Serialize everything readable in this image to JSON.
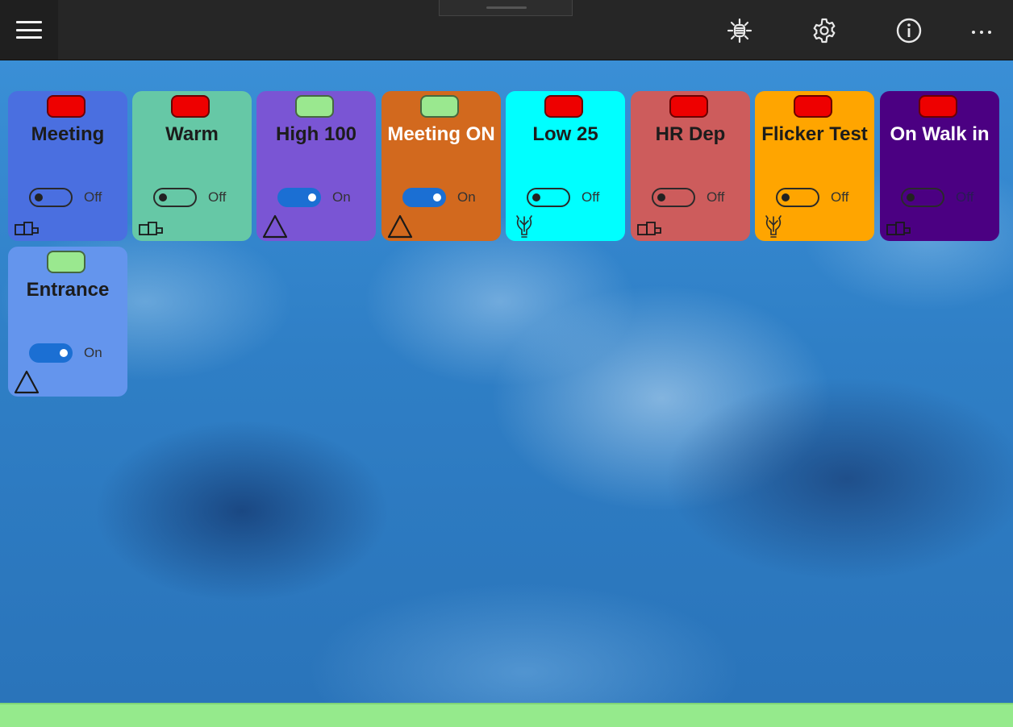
{
  "colors": {
    "titlebar": "#262626",
    "status_bar": "#95ea8c",
    "led_red": "#ee0000",
    "led_green": "#9ae88f",
    "toggle_on": "#1b6fd3"
  },
  "titlebar": {
    "menu_icon": "hamburger-icon",
    "actions": [
      {
        "name": "light-icon"
      },
      {
        "name": "settings-gear-icon"
      },
      {
        "name": "info-icon"
      },
      {
        "name": "more-icon"
      }
    ]
  },
  "tiles": [
    {
      "name": "Meeting",
      "state": "Off",
      "on": false,
      "led": "red",
      "color": "#4a6fe0",
      "icon": "plug-icon"
    },
    {
      "name": "Warm",
      "state": "Off",
      "on": false,
      "led": "red",
      "color": "#66c8a6",
      "icon": "plug-icon"
    },
    {
      "name": "High 100",
      "state": "On",
      "on": true,
      "led": "green",
      "color": "#7a55d4",
      "icon": "triangle-icon"
    },
    {
      "name": "Meeting ON",
      "state": "On",
      "on": true,
      "led": "green",
      "color": "#d2691e",
      "icon": "triangle-icon"
    },
    {
      "name": "Low 25",
      "state": "Off",
      "on": false,
      "led": "red",
      "color": "#00ffff",
      "icon": "bulb-icon"
    },
    {
      "name": "HR Dep",
      "state": "Off",
      "on": false,
      "led": "red",
      "color": "#cd5c5c",
      "icon": "plug-icon"
    },
    {
      "name": "Flicker Test",
      "state": "Off",
      "on": false,
      "led": "red",
      "color": "#ffa500",
      "icon": "bulb-icon"
    },
    {
      "name": "On Walk in",
      "state": "Off",
      "on": false,
      "led": "red",
      "color": "#4b0082",
      "icon": "plug-icon"
    },
    {
      "name": "Entrance",
      "state": "On",
      "on": true,
      "led": "green",
      "color": "#6495ed",
      "icon": "triangle-icon"
    }
  ]
}
